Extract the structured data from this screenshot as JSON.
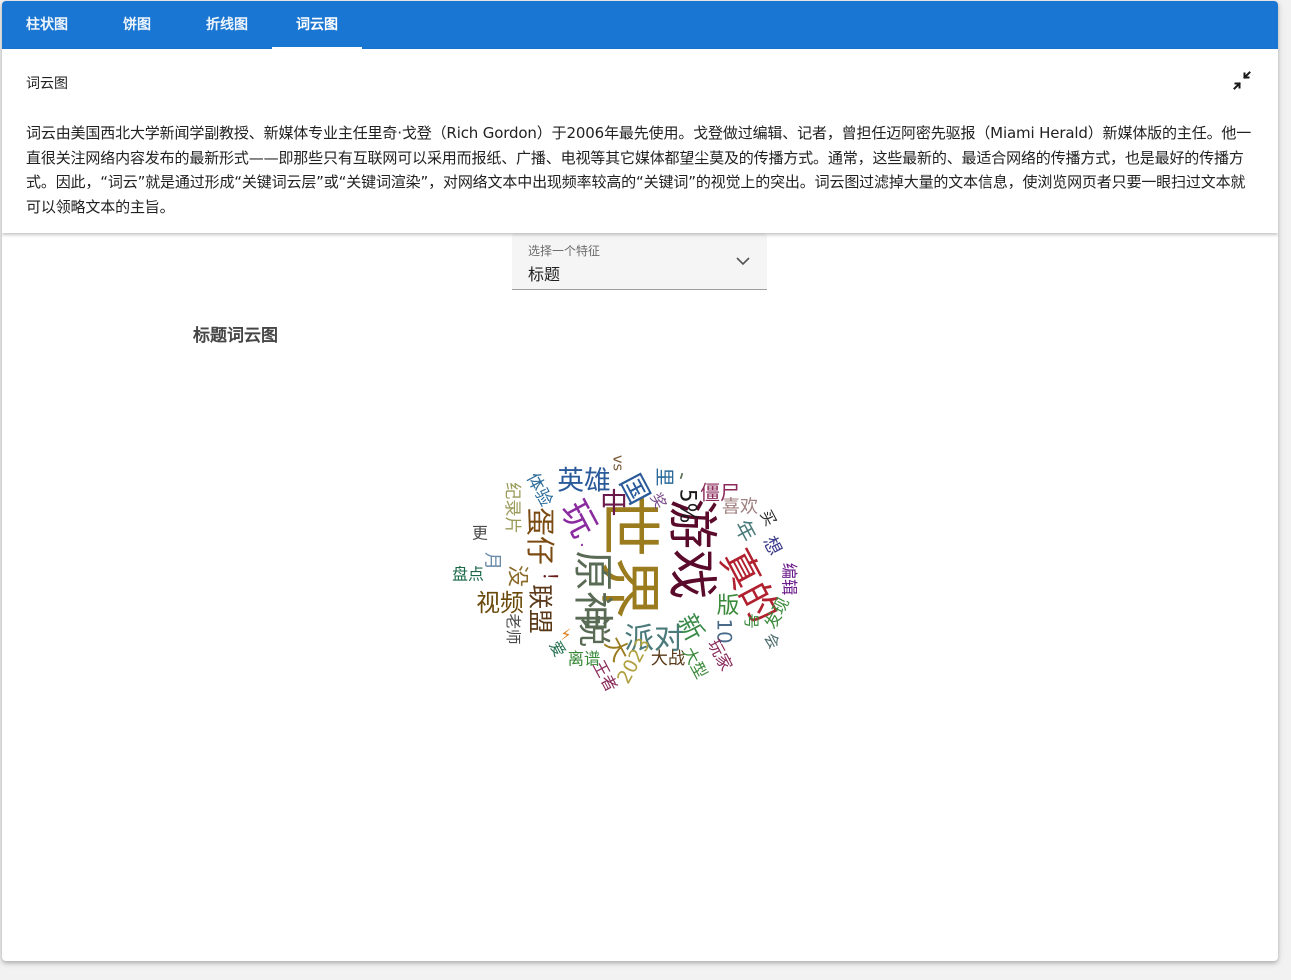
{
  "tabs": [
    {
      "label": "柱状图",
      "active": false
    },
    {
      "label": "饼图",
      "active": false
    },
    {
      "label": "折线图",
      "active": false
    },
    {
      "label": "词云图",
      "active": true
    }
  ],
  "description": {
    "title": "词云图",
    "text": "词云由美国西北大学新闻学副教授、新媒体专业主任里奇·戈登（Rich Gordon）于2006年最先使用。戈登做过编辑、记者，曾担任迈阿密先驱报（Miami Herald）新媒体版的主任。他一直很关注网络内容发布的最新形式——即那些只有互联网可以采用而报纸、广播、电视等其它媒体都望尘莫及的传播方式。通常，这些最新的、最适合网络的传播方式，也是最好的传播方式。因此，“词云”就是通过形成“关键词云层”或“关键词渲染”，对网络文本中出现频率较高的“关键词”的视觉上的突出。词云图过滤掉大量的文本信息，使浏览网页者只要一眼扫过文本就可以领略文本的主旨。",
    "collapse_icon": "collapse-icon"
  },
  "feature_select": {
    "label": "选择一个特征",
    "value": "标题",
    "icon": "chevron-down-icon"
  },
  "chart_title": "标题词云图",
  "chart_data": {
    "type": "wordcloud",
    "title": "标题词云图",
    "words": [
      {
        "text": "世界",
        "weight": 100,
        "color": "#9a7b1e"
      },
      {
        "text": "游戏",
        "weight": 80,
        "color": "#5a0a2a"
      },
      {
        "text": "原神",
        "weight": 62,
        "color": "#5a6b55"
      },
      {
        "text": "真的",
        "weight": 58,
        "color": "#b0202e"
      },
      {
        "text": "玩",
        "weight": 52,
        "color": "#8a2ba0"
      },
      {
        "text": "说",
        "weight": 48,
        "color": "#5a6b55"
      },
      {
        "text": "派对",
        "weight": 42,
        "color": "#4a7a7a"
      },
      {
        "text": "蛋仔",
        "weight": 40,
        "color": "#7a4a10"
      },
      {
        "text": "国",
        "weight": 40,
        "color": "#2a5a9a"
      },
      {
        "text": "中",
        "weight": 38,
        "color": "#6a1a4a"
      },
      {
        "text": "英雄",
        "weight": 36,
        "color": "#2a5a9a"
      },
      {
        "text": "新",
        "weight": 34,
        "color": "#3a8a4a"
      },
      {
        "text": "联盟",
        "weight": 32,
        "color": "#5a3a1a"
      },
      {
        "text": "大",
        "weight": 30,
        "color": "#9a7b1e"
      },
      {
        "text": "视频",
        "weight": 30,
        "color": "#6a4a0a"
      },
      {
        "text": "版",
        "weight": 28,
        "color": "#3a8a3a"
      },
      {
        "text": "没",
        "weight": 26,
        "color": "#8a6a2a"
      },
      {
        "text": "5%",
        "weight": 26,
        "color": "#1a1a1a"
      },
      {
        "text": "年",
        "weight": 24,
        "color": "#4a7a7a"
      },
      {
        "text": "僵尸",
        "weight": 22,
        "color": "#8a2a5a"
      },
      {
        "text": "10",
        "weight": 22,
        "color": "#4a6a8a"
      },
      {
        "text": "2023",
        "weight": 20,
        "color": "#b0a040"
      },
      {
        "text": "里",
        "weight": 20,
        "color": "#2a6a9a"
      },
      {
        "text": "喜欢",
        "weight": 18,
        "color": "#a08080"
      },
      {
        "text": "想",
        "weight": 18,
        "color": "#3a3a8a"
      },
      {
        "text": "月",
        "weight": 18,
        "color": "#6a8aaa"
      },
      {
        "text": "大战",
        "weight": 16,
        "color": "#5a3a1a"
      },
      {
        "text": "纪录片",
        "weight": 16,
        "color": "#9a9a5a"
      },
      {
        "text": "体验",
        "weight": 16,
        "color": "#2a6a9a"
      },
      {
        "text": "大型",
        "weight": 14,
        "color": "#3a8a3a"
      },
      {
        "text": "离谱",
        "weight": 14,
        "color": "#3a8a3a"
      },
      {
        "text": "王者",
        "weight": 14,
        "color": "#8a2a5a"
      },
      {
        "text": "发现",
        "weight": 14,
        "color": "#3a8a3a"
      },
      {
        "text": "玩家",
        "weight": 14,
        "color": "#8a2a5a"
      },
      {
        "text": "编辑",
        "weight": 14,
        "color": "#6a1a8a"
      },
      {
        "text": "盘点",
        "weight": 13,
        "color": "#1a6a4a"
      },
      {
        "text": "更",
        "weight": 13,
        "color": "#4a4a4a"
      },
      {
        "text": "买",
        "weight": 12,
        "color": "#2a2a2a"
      },
      {
        "text": "奖",
        "weight": 12,
        "color": "#7a4a8a"
      },
      {
        "text": "老师",
        "weight": 12,
        "color": "#4a4a4a"
      },
      {
        "text": "号",
        "weight": 12,
        "color": "#3a8a3a"
      },
      {
        "text": "爱",
        "weight": 12,
        "color": "#1a6a4a"
      },
      {
        "text": "会",
        "weight": 11,
        "color": "#4a6a6a"
      },
      {
        "text": "vs",
        "weight": 10,
        "color": "#7a5a3a"
      },
      {
        "text": "！",
        "weight": 20,
        "color": "#6a1a1a"
      },
      {
        "text": "、",
        "weight": 20,
        "color": "#5a6b55"
      },
      {
        "text": "·",
        "weight": 16,
        "color": "#8a2ba0"
      },
      {
        "text": "⚡",
        "weight": 12,
        "color": "#e07a10"
      }
    ]
  }
}
